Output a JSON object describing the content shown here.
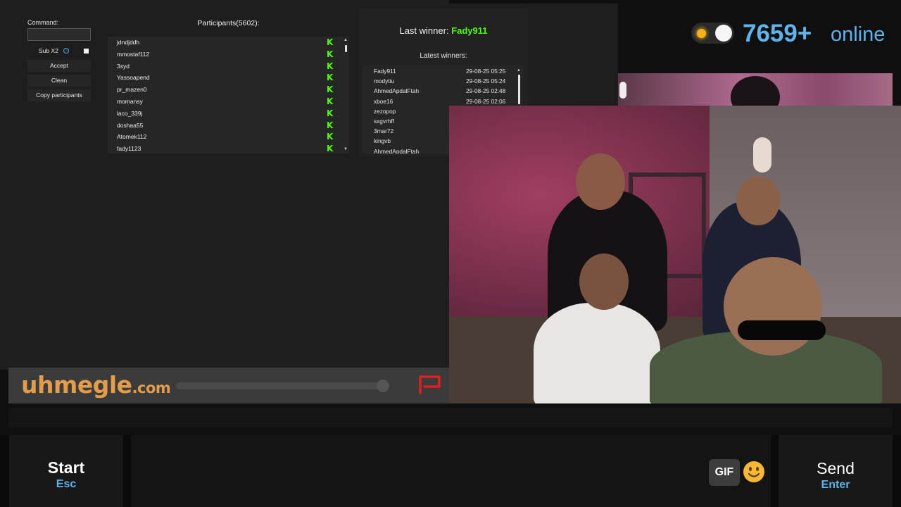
{
  "giveaway": {
    "command_label": "Command:",
    "command_value": "",
    "sub_label": "Sub X2",
    "info_icon": "i",
    "buttons": {
      "accept": "Accept",
      "clean": "Clean",
      "copy": "Copy participants"
    },
    "participants_title": "Participants(5602):",
    "participants": [
      "jdndjddh",
      "mmostaf112",
      "3syd",
      "Yassoapend",
      "pr_mazen0",
      "momansy",
      "laco_339j",
      "doshaa55",
      "Atomek112",
      "fady1123"
    ],
    "participant_badge": "K",
    "last_winner_label": "Last winner:",
    "last_winner": "Fady911",
    "latest_winners_title": "Latest winners:",
    "latest_winners": [
      {
        "name": "Fady911",
        "date": "29-08-25 05:25"
      },
      {
        "name": "modytiu",
        "date": "29-08-25 05:24"
      },
      {
        "name": "AhmedApdalFtah",
        "date": "29-08-25 02:48"
      },
      {
        "name": "xboe16",
        "date": "29-08-25 02:06"
      },
      {
        "name": "zezopop",
        "date": ""
      },
      {
        "name": "sxgvrhff",
        "date": ""
      },
      {
        "name": "3mar72",
        "date": ""
      },
      {
        "name": "kingvb",
        "date": ""
      },
      {
        "name": "AhmedApdalFtah",
        "date": ""
      }
    ],
    "colors": {
      "accent": "#53fc18"
    }
  },
  "online": {
    "count": "7659+",
    "label": "online",
    "color": "#5fb3ea"
  },
  "banner": {
    "logo_main": "uhmegle",
    "logo_suffix": ".com"
  },
  "bottom": {
    "start_label": "Start",
    "start_key": "Esc",
    "gif_label": "GIF",
    "emoji_icon": "smiley-emoji",
    "send_label": "Send",
    "send_key": "Enter"
  }
}
